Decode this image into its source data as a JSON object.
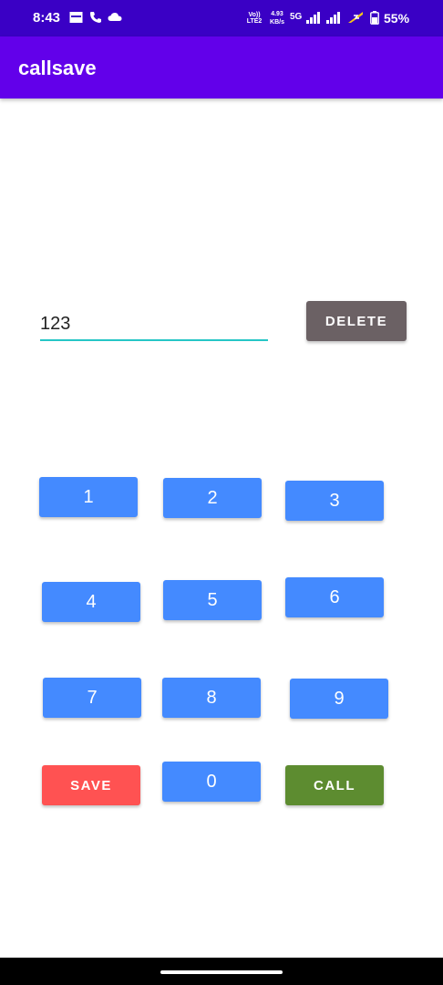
{
  "status_bar": {
    "time": "8:43",
    "network_label_top": "Vo)) LTE2",
    "speed_value": "4.93",
    "speed_unit": "KB/s",
    "network_type": "5G",
    "battery_percent": "55%"
  },
  "app_bar": {
    "title": "callsave"
  },
  "input": {
    "value": "123"
  },
  "buttons": {
    "delete": "DELETE",
    "save": "SAVE",
    "call": "CALL",
    "keys": [
      "1",
      "2",
      "3",
      "4",
      "5",
      "6",
      "7",
      "8",
      "9",
      "0"
    ]
  },
  "colors": {
    "status_bar": "#3a00c5",
    "app_bar": "#6200ea",
    "key": "#448aff",
    "delete": "#6b6164",
    "save": "#ff5252",
    "call": "#5d8c30",
    "input_underline": "#26c6c6"
  }
}
